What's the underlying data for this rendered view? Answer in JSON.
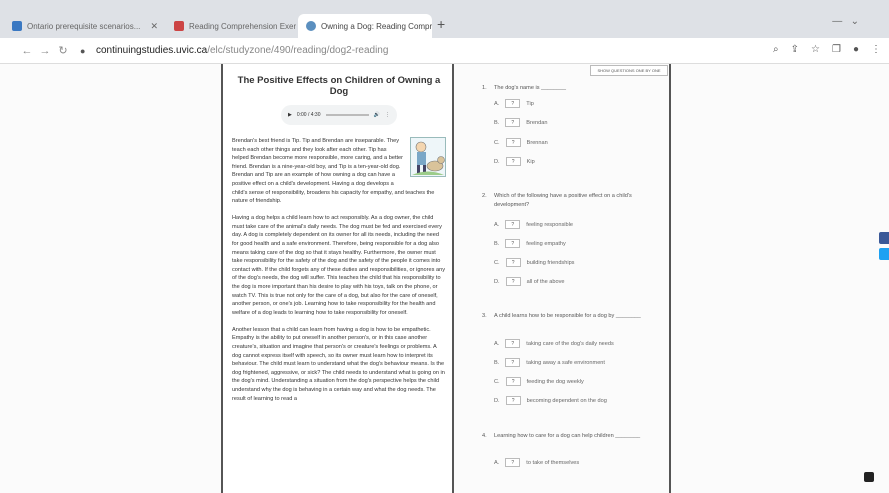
{
  "browser": {
    "tabs": [
      {
        "label": "Ontario prerequisite scenarios..."
      },
      {
        "label": "Reading Comprehension Exercises"
      },
      {
        "label": "Owning a Dog: Reading Compreh..."
      }
    ],
    "new_tab": "+",
    "url_host": "continuingstudies.uvic.ca",
    "url_path": "/elc/studyzone/490/reading/dog2-reading"
  },
  "reading": {
    "title": "The Positive Effects on Children of Owning a Dog",
    "audio_time": "0:00 / 4:30",
    "paragraphs": [
      "Brendan's best friend is Tip. Tip and Brendan are inseparable. They teach each other things and they look after each other. Tip has helped Brendan become more responsible, more caring, and a better friend. Brendan is a nine-year-old boy, and Tip is a ten-year-old dog. Brendan and Tip are an example of how owning a dog can have a positive effect on a child's development. Having a dog develops a child's sense of responsibility, broadens his capacity for empathy, and teaches the nature of friendship.",
      "Having a dog helps a child learn how to act responsibly. As a dog owner, the child must take care of the animal's daily needs. The dog must be fed and exercised every day. A dog is completely dependent on its owner for all its needs, including the need for good health and a safe environment. Therefore, being responsible for a dog also means taking care of the dog so that it stays healthy. Furthermore, the owner must take responsibility for the safety of the dog and the safety of the people it comes into contact with. If the child forgets any of these duties and responsibilities, or ignores any of the dog's needs, the dog will suffer. This teaches the child that his responsibility to the dog is more important than his desire to play with his toys, talk on the phone, or watch TV. This is true not only for the care of a dog, but also for the care of oneself, another person, or one's job. Learning how to take responsibility for the health and welfare of a dog leads to learning how to take responsibility for oneself.",
      "Another lesson that a child can learn from having a dog is how to be empathetic. Empathy is the ability to put oneself in another person's, or in this case another creature's, situation and imagine that person's or creature's feelings or problems. A dog cannot express itself with speech, so its owner must learn how to interpret its behaviour. The child must learn to understand what the dog's behaviour means. Is the dog frightened, aggressive, or sick? The child needs to understand what is going on in the dog's mind. Understanding a situation from the dog's perspective helps the child understand why the dog is behaving in a certain way and what the dog needs. The result of learning to read a"
    ]
  },
  "questions": {
    "show_one_by_one": "SHOW QUESTIONS ONE BY ONE",
    "items": [
      {
        "num": "1.",
        "text": "The dog's name is ________",
        "options": [
          {
            "letter": "A.",
            "value": "?",
            "text": "Tip"
          },
          {
            "letter": "B.",
            "value": "?",
            "text": "Brendan"
          },
          {
            "letter": "C.",
            "value": "?",
            "text": "Brennan"
          },
          {
            "letter": "D.",
            "value": "?",
            "text": "Kip"
          }
        ]
      },
      {
        "num": "2.",
        "text": "Which of the following have a positive effect on a child's development?",
        "options": [
          {
            "letter": "A.",
            "value": "?",
            "text": "feeling responsible"
          },
          {
            "letter": "B.",
            "value": "?",
            "text": "feeling empathy"
          },
          {
            "letter": "C.",
            "value": "?",
            "text": "building friendships"
          },
          {
            "letter": "D.",
            "value": "?",
            "text": "all of the above"
          }
        ]
      },
      {
        "num": "3.",
        "text": "A child learns how to be responsible for a dog by ________",
        "options": [
          {
            "letter": "A.",
            "value": "?",
            "text": "taking care of the dog's daily needs"
          },
          {
            "letter": "B.",
            "value": "?",
            "text": "taking away a safe environment"
          },
          {
            "letter": "C.",
            "value": "?",
            "text": "feeding the dog weekly"
          },
          {
            "letter": "D.",
            "value": "?",
            "text": "becoming dependent on the dog"
          }
        ]
      },
      {
        "num": "4.",
        "text": "Learning how to care for a dog can help children ________",
        "options": [
          {
            "letter": "A.",
            "value": "?",
            "text": "to take of themselves"
          }
        ]
      }
    ]
  }
}
